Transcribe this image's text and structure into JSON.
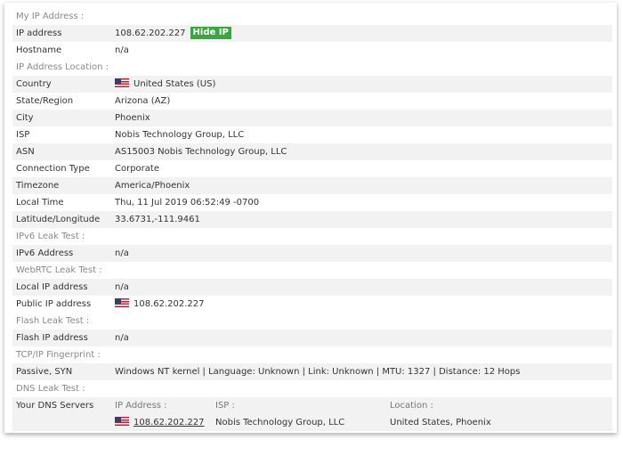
{
  "sections": {
    "my_ip": "My IP Address :",
    "location": "IP Address Location :",
    "ipv6": "IPv6 Leak Test :",
    "webrtc": "WebRTC Leak Test :",
    "flash": "Flash Leak Test :",
    "tcpip": "TCP/IP Fingerprint :",
    "dns": "DNS Leak Test :"
  },
  "my_ip": {
    "ip_label": "IP address",
    "ip_value": "108.62.202.227",
    "hide_button": "Hide IP",
    "hostname_label": "Hostname",
    "hostname_value": "n/a"
  },
  "location": {
    "country_label": "Country",
    "country_value": "United States (US)",
    "state_label": "State/Region",
    "state_value": "Arizona (AZ)",
    "city_label": "City",
    "city_value": "Phoenix",
    "isp_label": "ISP",
    "isp_value": "Nobis Technology Group, LLC",
    "asn_label": "ASN",
    "asn_value": "AS15003 Nobis Technology Group, LLC",
    "conn_label": "Connection Type",
    "conn_value": "Corporate",
    "tz_label": "Timezone",
    "tz_value": "America/Phoenix",
    "time_label": "Local Time",
    "time_value": "Thu, 11 Jul 2019 06:52:49 -0700",
    "latlon_label": "Latitude/Longitude",
    "latlon_value": "33.6731,-111.9461"
  },
  "ipv6": {
    "label": "IPv6 Address",
    "value": "n/a"
  },
  "webrtc": {
    "local_label": "Local IP address",
    "local_value": "n/a",
    "public_label": "Public IP address",
    "public_value": "108.62.202.227"
  },
  "flash": {
    "label": "Flash IP address",
    "value": "n/a"
  },
  "tcpip": {
    "label": "Passive, SYN",
    "value": "Windows NT kernel | Language: Unknown | Link: Unknown | MTU: 1327 | Distance: 12 Hops"
  },
  "dns": {
    "label": "Your DNS Servers",
    "col_ip": "IP Address :",
    "col_isp": "ISP :",
    "col_location": "Location :",
    "ip": "108.62.202.227",
    "isp": "Nobis Technology Group, LLC",
    "location": "United States, Phoenix"
  },
  "icons": {
    "flag": "us-flag-icon"
  },
  "colors": {
    "hide_button": "#3aa641",
    "row_alt": "#f2f2f2",
    "section_text": "#888888"
  }
}
